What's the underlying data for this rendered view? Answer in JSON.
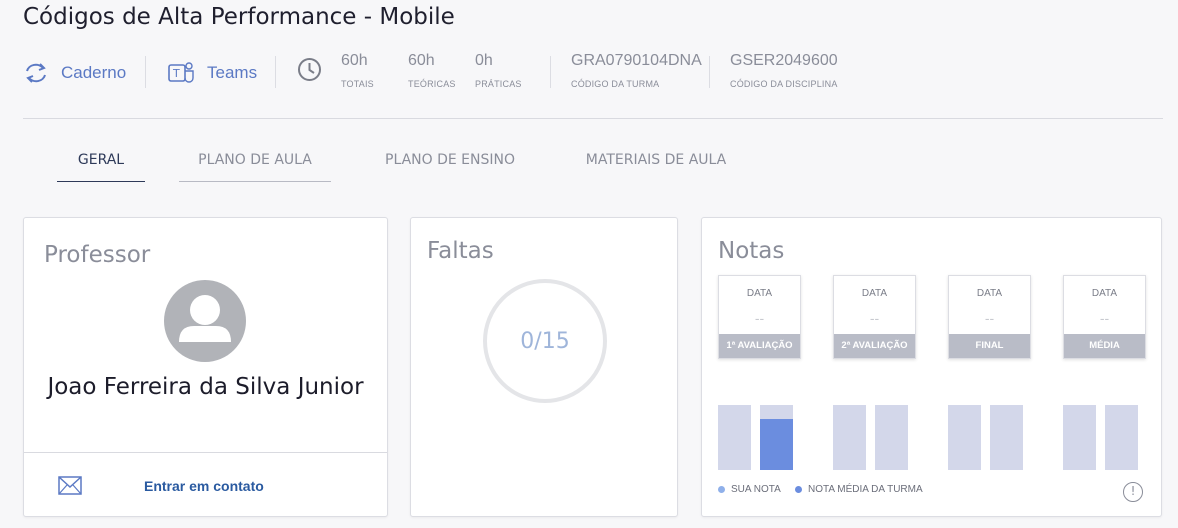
{
  "page": {
    "title": "Códigos de Alta Performance - Mobile"
  },
  "links": {
    "caderno": "Caderno",
    "teams": "Teams"
  },
  "hours": [
    {
      "value": "60h",
      "label": "TOTAIS"
    },
    {
      "value": "60h",
      "label": "TEÓRICAS"
    },
    {
      "value": "0h",
      "label": "PRÁTICAS"
    }
  ],
  "codes": [
    {
      "value": "GRA0790104DNA",
      "label": "CÓDIGO DA TURMA"
    },
    {
      "value": "GSER2049600",
      "label": "CÓDIGO DA DISCIPLINA"
    }
  ],
  "tabs": [
    {
      "label": "GERAL"
    },
    {
      "label": "PLANO DE AULA"
    },
    {
      "label": "PLANO DE ENSINO"
    },
    {
      "label": "MATERIAIS DE AULA"
    }
  ],
  "professor": {
    "title": "Professor",
    "name": "Joao Ferreira da Silva Junior",
    "contact": "Entrar em contato"
  },
  "faltas": {
    "title": "Faltas",
    "value": "0/15"
  },
  "notas": {
    "title": "Notas",
    "cards": [
      {
        "date_label": "DATA",
        "date_value": "--",
        "label": "1ª AVALIAÇÃO"
      },
      {
        "date_label": "DATA",
        "date_value": "--",
        "label": "2ª AVALIAÇÃO"
      },
      {
        "date_label": "DATA",
        "date_value": "--",
        "label": "FINAL"
      },
      {
        "date_label": "DATA",
        "date_value": "--",
        "label": "MÉDIA"
      }
    ],
    "bars": [
      {
        "sua_nota": 0,
        "media_turma": 0.78
      },
      {
        "sua_nota": 0,
        "media_turma": 0
      },
      {
        "sua_nota": 0,
        "media_turma": 0
      },
      {
        "sua_nota": 0,
        "media_turma": 0
      }
    ],
    "legend": {
      "sua_nota": "SUA NOTA",
      "media_turma": "NOTA MÉDIA DA TURMA"
    },
    "colors": {
      "sua_nota": "#8fb0ea",
      "media_turma": "#6b8ddf",
      "bar_bg": "#d3d7ea"
    }
  },
  "colors": {
    "accent": "#5b79c4",
    "link": "#2a5aa0"
  }
}
